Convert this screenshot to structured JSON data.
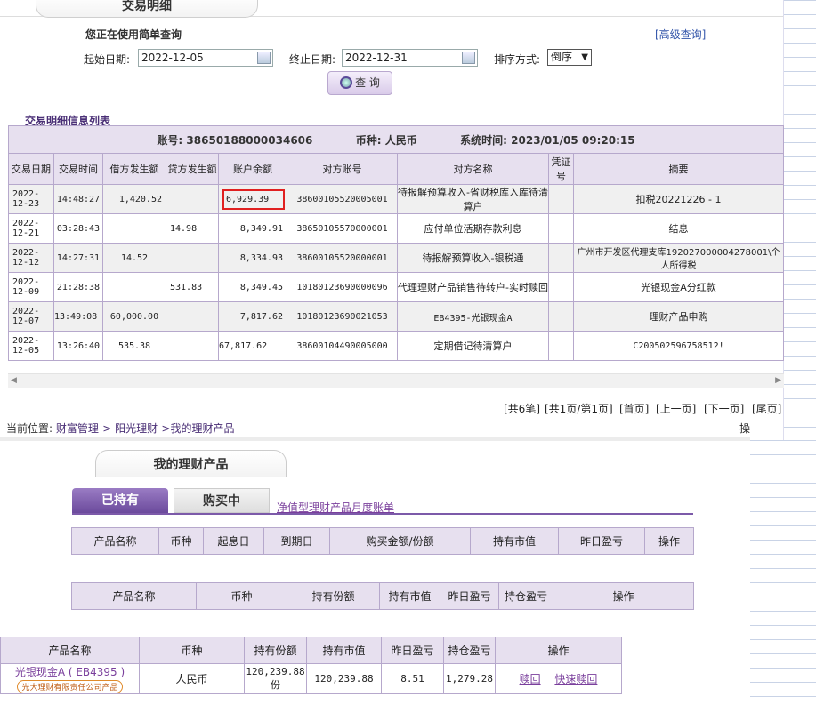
{
  "header": {
    "tab_title": "交易明细"
  },
  "query": {
    "notice": "您正在使用简单查询",
    "advanced_link": "[高级查询]",
    "start_label": "起始日期:",
    "start_value": "2022-12-05",
    "end_label": "终止日期:",
    "end_value": "2022-12-31",
    "sort_label": "排序方式:",
    "sort_value": "倒序",
    "query_button": "查 询"
  },
  "list": {
    "title": "交易明细信息列表",
    "account_label": "账号:",
    "account_value": "38650188000034606",
    "currency_label": "币种:",
    "currency_value": "人民币",
    "systime_label": "系统时间:",
    "systime_value": "2023/01/05 09:20:15",
    "columns": [
      "交易日期",
      "交易时间",
      "借方发生额",
      "贷方发生额",
      "账户余额",
      "对方账号",
      "对方名称",
      "凭证号",
      "摘要"
    ],
    "rows": [
      {
        "date": "2022-12-23",
        "time": "14:48:27",
        "debit": "1,420.52",
        "credit": "",
        "balance": "6,929.39",
        "cp_account": "38600105520005001",
        "cp_name": "待报解预算收入-省财税库入库待清算户",
        "voucher": "",
        "summary": "扣税20221226 - 1"
      },
      {
        "date": "2022-12-21",
        "time": "03:28:43",
        "debit": "",
        "credit": "14.98",
        "balance": "8,349.91",
        "cp_account": "38650105570000001",
        "cp_name": "应付单位活期存款利息",
        "voucher": "",
        "summary": "结息"
      },
      {
        "date": "2022-12-12",
        "time": "14:27:31",
        "debit": "14.52",
        "credit": "",
        "balance": "8,334.93",
        "cp_account": "38600105520000001",
        "cp_name": "待报解预算收入-银税通",
        "voucher": "",
        "summary": "广州市开发区代理支库192027000004278001\\个人所得税"
      },
      {
        "date": "2022-12-09",
        "time": "21:28:38",
        "debit": "",
        "credit": "531.83",
        "balance": "8,349.45",
        "cp_account": "10180123690000096",
        "cp_name": "代理理财产品销售待转户-实时赎回",
        "voucher": "",
        "summary": "光银现金A分红款"
      },
      {
        "date": "2022-12-07",
        "time": "13:49:08",
        "debit": "60,000.00",
        "credit": "",
        "balance": "7,817.62",
        "cp_account": "10180123690021053",
        "cp_name": "EB4395-光银现金A",
        "voucher": "",
        "summary": "理财产品申购"
      },
      {
        "date": "2022-12-05",
        "time": "13:26:40",
        "debit": "535.38",
        "credit": "",
        "balance": "67,817.62",
        "cp_account": "38600104490005000",
        "cp_name": "定期借记待清算户",
        "voucher": "",
        "summary": "C200502596758512!"
      }
    ]
  },
  "pager": {
    "total": "[共6笔]",
    "pages": "[共1页/第1页]",
    "first": "[首页]",
    "prev": "[上一页]",
    "next": "[下一页]",
    "last": "[尾页]"
  },
  "breadcrumb": {
    "prefix": "当前位置:",
    "part1": "财富管理->",
    "part2": "阳光理财->我的理财产品",
    "side": "操"
  },
  "products": {
    "tab_title": "我的理财产品",
    "tab_held": "已持有",
    "tab_buying": "购买中",
    "nav_link": "净值型理财产品月度账单",
    "table1_columns": [
      "产品名称",
      "币种",
      "起息日",
      "到期日",
      "购买金额/份额",
      "持有市值",
      "昨日盈亏",
      "操作"
    ],
    "table2_columns": [
      "产品名称",
      "币种",
      "持有份额",
      "持有市值",
      "昨日盈亏",
      "持仓盈亏",
      "操作"
    ],
    "table3_columns": [
      "产品名称",
      "币种",
      "持有份额",
      "持有市值",
      "昨日盈亏",
      "持仓盈亏",
      "操作"
    ],
    "holding": {
      "name": "光银现金A ( EB4395 )",
      "issuer": "光大理财有限责任公司产品",
      "currency": "人民币",
      "shares": "120,239.88份",
      "market_value": "120,239.88",
      "yesterday_pnl": "8.51",
      "position_pnl": "1,279.28",
      "action_redeem": "赎回",
      "action_fast_redeem": "快速赎回"
    }
  }
}
